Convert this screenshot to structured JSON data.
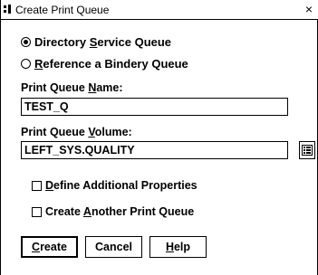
{
  "window": {
    "title": "Create Print Queue",
    "close_glyph": "×"
  },
  "queue_type": {
    "directory_label_pre": "Directory ",
    "directory_label_ul": "S",
    "directory_label_post": "ervice Queue",
    "directory_selected": true,
    "bindery_label_ul": "R",
    "bindery_label_post": "eference a Bindery Queue",
    "bindery_selected": false
  },
  "queue_name": {
    "label_pre": "Print Queue ",
    "label_ul": "N",
    "label_post": "ame:",
    "value": "TEST_Q"
  },
  "queue_volume": {
    "label_pre": "Print Queue ",
    "label_ul": "V",
    "label_post": "olume:",
    "value": "LEFT_SYS.QUALITY",
    "browse_icon": "tree-browse-icon"
  },
  "options": {
    "define_ul": "D",
    "define_post": "efine Additional Properties",
    "define_checked": false,
    "another_pre": "Create ",
    "another_ul": "A",
    "another_post": "nother Print Queue",
    "another_checked": false
  },
  "buttons": {
    "create_ul": "C",
    "create_post": "reate",
    "cancel": "Cancel",
    "help_ul": "H",
    "help_post": "elp"
  }
}
